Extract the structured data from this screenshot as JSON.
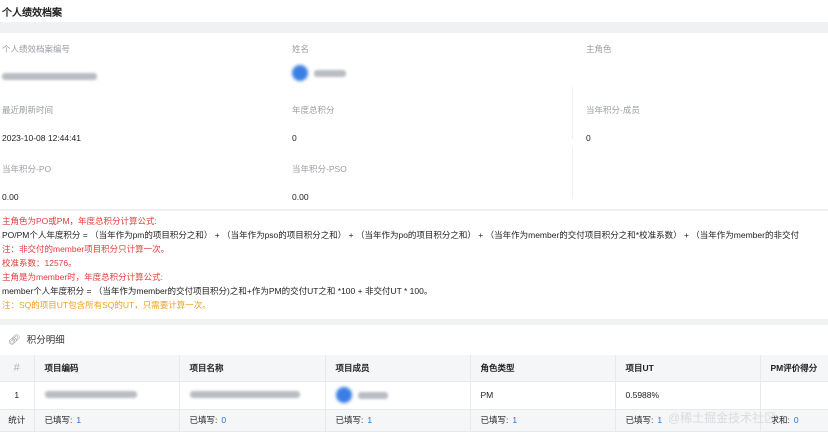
{
  "page_title": "个人绩效档案",
  "fields": {
    "archive_no_label": "个人绩效档案编号",
    "name_label": "姓名",
    "main_role_label": "主角色",
    "last_refresh_label": "最近刷新时间",
    "last_refresh_value": "2023-10-08 12:44:41",
    "annual_total_label": "年度总积分",
    "annual_total_value": "0",
    "year_points_member_label": "当年积分-成员",
    "year_points_member_value": "0",
    "year_points_po_label": "当年积分-PO",
    "year_points_po_value": "0.00",
    "year_points_pso_label": "当年积分-PSO",
    "year_points_pso_value": "0.00"
  },
  "formula": {
    "line1": "主角色为PO或PM，年度总积分计算公式:",
    "line2": "PO/PM个人年度积分 = （当年作为pm的项目积分之和） + （当年作为pso的项目积分之和） + （当年作为po的项目积分之和） + （当年作为member的交付项目积分之和*校准系数） + （当年作为member的非交付",
    "line3": "注：非交付的member项目积分只计算一次。",
    "line4": "校准系数：12576。",
    "line5": "主角是为member时，年度总积分计算公式:",
    "line6": "member个人年度积分 = （当年作为member的交付项目积分)之和+作为PM的交付UT之和 *100 + 非交付UT * 100。",
    "line7": "注：SQ的项目UT包含所有SQ的UT，只需要计算一次。"
  },
  "detail": {
    "title": "积分明细",
    "columns": [
      "#",
      "项目编码",
      "项目名称",
      "项目成员",
      "角色类型",
      "项目UT",
      "PM评价得分"
    ],
    "rows": [
      {
        "idx": "1",
        "role_type": "PM",
        "project_ut": "0.5988%"
      }
    ],
    "stats": {
      "label": "统计",
      "filled_label": "已填写:",
      "code_count": "1",
      "name_count": "0",
      "member_count": "1",
      "role_count": "1",
      "ut_count": "1",
      "eval_label": "求和:",
      "eval_value": "0"
    }
  },
  "watermark": "@稀土掘金技术社区",
  "colors": {
    "warning_red": "#e23b3b",
    "note_orange": "#f0a020",
    "link_blue": "#1e6fd9"
  }
}
